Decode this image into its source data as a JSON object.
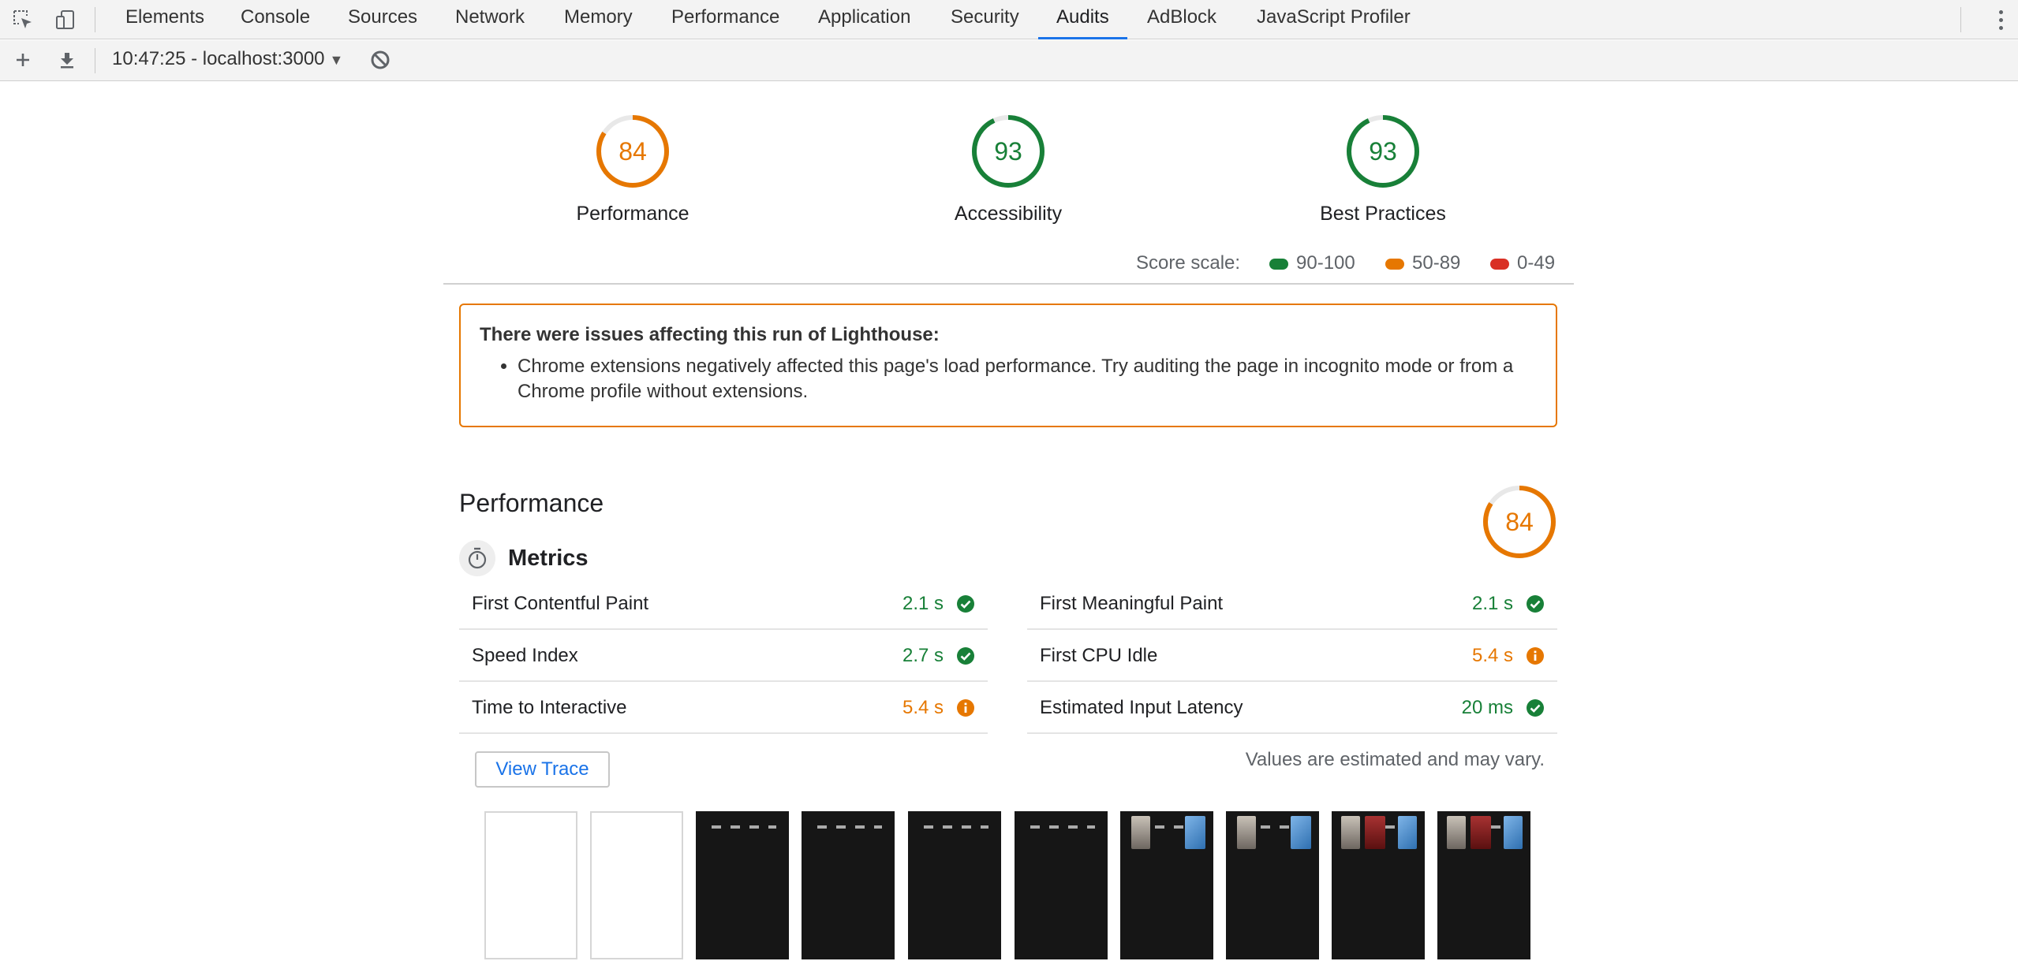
{
  "devtools": {
    "tabs": [
      "Elements",
      "Console",
      "Sources",
      "Network",
      "Memory",
      "Performance",
      "Application",
      "Security",
      "Audits",
      "AdBlock",
      "JavaScript Profiler"
    ],
    "active_tab": "Audits"
  },
  "toolbar": {
    "report": "10:47:25 - localhost:3000",
    "add_icon": "plus-icon",
    "download_icon": "download-icon",
    "clear_icon": "block-icon"
  },
  "summary": {
    "gauges": [
      {
        "label": "Performance",
        "score": "84",
        "value": 84,
        "color": "#e67700"
      },
      {
        "label": "Accessibility",
        "score": "93",
        "value": 93,
        "color": "#188038"
      },
      {
        "label": "Best Practices",
        "score": "93",
        "value": 93,
        "color": "#188038"
      }
    ]
  },
  "scale": {
    "label": "Score scale:",
    "ranges": [
      {
        "label": "90-100",
        "color": "#188038"
      },
      {
        "label": "50-89",
        "color": "#e67700"
      },
      {
        "label": "0-49",
        "color": "#d93025"
      }
    ]
  },
  "warning": {
    "title": "There were issues affecting this run of Lighthouse:",
    "items": [
      "Chrome extensions negatively affected this page's load performance. Try auditing the page in incognito mode or from a Chrome profile without extensions."
    ],
    "color": "#e67700"
  },
  "performance": {
    "title": "Performance",
    "score": "84",
    "value": 84,
    "metrics_title": "Metrics",
    "metrics": [
      {
        "label": "First Contentful Paint",
        "value": "2.1 s",
        "status": "pass"
      },
      {
        "label": "First Meaningful Paint",
        "value": "2.1 s",
        "status": "pass"
      },
      {
        "label": "Speed Index",
        "value": "2.7 s",
        "status": "pass"
      },
      {
        "label": "First CPU Idle",
        "value": "5.4 s",
        "status": "average"
      },
      {
        "label": "Time to Interactive",
        "value": "5.4 s",
        "status": "average"
      },
      {
        "label": "Estimated Input Latency",
        "value": "20 ms",
        "status": "pass"
      }
    ],
    "view_trace": "View Trace",
    "note": "Values are estimated and may vary."
  },
  "colors": {
    "pass": "#188038",
    "average": "#e67700",
    "fail": "#d93025",
    "accent": "#1a73e8"
  }
}
